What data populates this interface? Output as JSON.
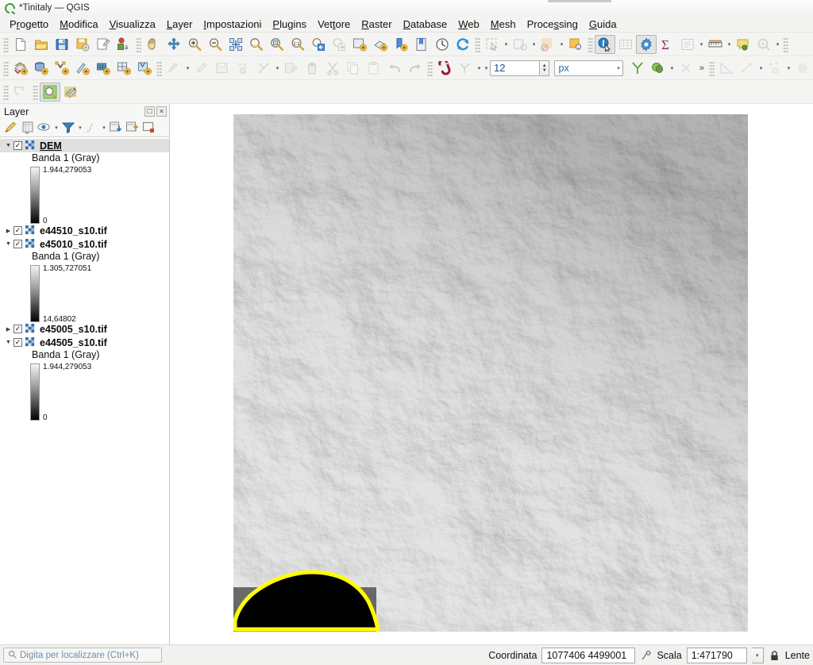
{
  "window": {
    "title": "*Tinitaly — QGIS",
    "logo_icon": "qgis-logo-icon"
  },
  "menubar": {
    "items": [
      {
        "label": "Progetto",
        "mnemonic_index": 1
      },
      {
        "label": "Modifica",
        "mnemonic_index": 0
      },
      {
        "label": "Visualizza",
        "mnemonic_index": 0
      },
      {
        "label": "Layer",
        "mnemonic_index": 0
      },
      {
        "label": "Impostazioni",
        "mnemonic_index": 0
      },
      {
        "label": "Plugins",
        "mnemonic_index": 0
      },
      {
        "label": "Vettore",
        "mnemonic_index": 3
      },
      {
        "label": "Raster",
        "mnemonic_index": 0
      },
      {
        "label": "Database",
        "mnemonic_index": 0
      },
      {
        "label": "Web",
        "mnemonic_index": 0
      },
      {
        "label": "Mesh",
        "mnemonic_index": 0
      },
      {
        "label": "Processing",
        "mnemonic_index": 5
      },
      {
        "label": "Guida",
        "mnemonic_index": 0
      }
    ]
  },
  "toolbars": {
    "row1": [
      {
        "icon": "new-project-icon",
        "name": "new-project-button"
      },
      {
        "icon": "open-project-icon",
        "name": "open-project-button"
      },
      {
        "icon": "save-project-icon",
        "name": "save-project-button"
      },
      {
        "icon": "save-project-as-icon",
        "name": "save-project-as-button"
      },
      {
        "icon": "new-print-layout-icon",
        "name": "new-print-layout-button"
      },
      {
        "icon": "layout-manager-icon",
        "name": "layout-manager-button"
      },
      {
        "icon": "pan-map-icon",
        "name": "pan-map-button"
      },
      {
        "icon": "pan-to-selection-icon",
        "name": "pan-to-selection-button"
      },
      {
        "icon": "zoom-in-icon",
        "name": "zoom-in-button"
      },
      {
        "icon": "zoom-out-icon",
        "name": "zoom-out-button"
      },
      {
        "icon": "zoom-full-icon",
        "name": "zoom-full-button"
      },
      {
        "icon": "zoom-to-selection-icon",
        "name": "zoom-to-selection-button"
      },
      {
        "icon": "zoom-to-layer-icon",
        "name": "zoom-to-layer-button"
      },
      {
        "icon": "zoom-native-icon",
        "name": "zoom-native-resolution-button"
      },
      {
        "icon": "zoom-last-icon",
        "name": "zoom-last-button"
      },
      {
        "icon": "zoom-next-icon",
        "name": "zoom-next-button"
      },
      {
        "icon": "new-map-view-icon",
        "name": "new-map-view-button"
      },
      {
        "icon": "new-3d-map-view-icon",
        "name": "new-3d-map-view-button"
      },
      {
        "icon": "new-bookmark-icon",
        "name": "new-bookmark-button"
      },
      {
        "icon": "show-bookmarks-icon",
        "name": "show-bookmarks-button"
      },
      {
        "icon": "temporal-controller-icon",
        "name": "temporal-controller-button"
      },
      {
        "icon": "refresh-icon",
        "name": "refresh-button"
      },
      {
        "icon": "select-features-icon",
        "name": "select-features-button"
      },
      {
        "icon": "select-by-expression-icon",
        "name": "select-by-expression-button"
      },
      {
        "icon": "deselect-features-icon",
        "name": "deselect-features-button"
      },
      {
        "icon": "select-value-icon",
        "name": "select-value-button"
      },
      {
        "icon": "identify-features-icon",
        "name": "identify-features-button"
      },
      {
        "icon": "open-attribute-table-icon",
        "name": "open-attribute-table-button"
      },
      {
        "icon": "processing-toolbox-icon",
        "name": "processing-toolbox-button"
      },
      {
        "icon": "statistical-summary-icon",
        "name": "statistical-summary-button"
      },
      {
        "icon": "show-statistics-icon",
        "name": "show-statistics-button"
      },
      {
        "icon": "measure-line-icon",
        "name": "measure-line-button"
      },
      {
        "icon": "map-tips-icon",
        "name": "map-tips-button"
      },
      {
        "icon": "show-styling-icon",
        "name": "show-styling-button"
      }
    ],
    "row2": [
      {
        "icon": "add-raster-layer-icon",
        "name": "add-raster-layer-button"
      },
      {
        "icon": "add-db-layer-icon",
        "name": "add-db-layer-button"
      },
      {
        "icon": "add-vector-layer-icon",
        "name": "add-vector-layer-button"
      },
      {
        "icon": "add-pointcloud-layer-icon",
        "name": "add-pointcloud-layer-button"
      },
      {
        "icon": "add-mesh-layer-icon",
        "name": "add-mesh-layer-button"
      },
      {
        "icon": "add-wms-layer-icon",
        "name": "add-wms-layer-button"
      },
      {
        "icon": "add-wfs-layer-icon",
        "name": "add-wfs-layer-button"
      },
      {
        "icon": "current-edits-icon",
        "name": "current-edits-button"
      },
      {
        "icon": "toggle-editing-icon",
        "name": "toggle-editing-button"
      },
      {
        "icon": "save-layer-edits-icon",
        "name": "save-layer-edits-button"
      },
      {
        "icon": "add-feature-icon",
        "name": "add-feature-button"
      },
      {
        "icon": "vertex-tool-icon",
        "name": "vertex-tool-button"
      },
      {
        "icon": "modify-attributes-icon",
        "name": "modify-attributes-button"
      },
      {
        "icon": "delete-selected-icon",
        "name": "delete-selected-button"
      },
      {
        "icon": "cut-features-icon",
        "name": "cut-features-button"
      },
      {
        "icon": "copy-features-icon",
        "name": "copy-features-button"
      },
      {
        "icon": "paste-features-icon",
        "name": "paste-features-button"
      },
      {
        "icon": "undo-icon",
        "name": "undo-button"
      },
      {
        "icon": "redo-icon",
        "name": "redo-button"
      },
      {
        "icon": "snapping-magnet-icon",
        "name": "snapping-toggle-button"
      },
      {
        "icon": "snapping-mode-icon",
        "name": "snapping-mode-button"
      },
      {
        "icon": "topology-intersection-icon",
        "name": "avoid-overlap-button"
      },
      {
        "icon": "trace-icon",
        "name": "enable-tracing-button"
      },
      {
        "icon": "no-snap-icon",
        "name": "self-snapping-button"
      },
      {
        "icon": "measure-angle-icon",
        "name": "measure-angle-button"
      },
      {
        "icon": "offset-curve-icon",
        "name": "offset-curve-button"
      },
      {
        "icon": "reshape-features-icon",
        "name": "reshape-features-button"
      }
    ],
    "row3": [
      {
        "icon": "select-polygon-icon",
        "name": "select-polygon-button"
      },
      {
        "icon": "zoom-search-icon",
        "name": "metasearch-button"
      },
      {
        "icon": "georeferencer-icon",
        "name": "georeferencer-button"
      }
    ],
    "snapping_tolerance": {
      "value": "12",
      "units": "px",
      "name": "snapping-tolerance"
    },
    "overflow_label": "»"
  },
  "layer_panel": {
    "title": "Layer",
    "float_button": "panel-float-icon",
    "close_button": "panel-close-icon",
    "tools": [
      {
        "icon": "open-layer-styling-icon",
        "name": "open-layer-styling-panel"
      },
      {
        "icon": "add-group-icon",
        "name": "add-group-button"
      },
      {
        "icon": "manage-layer-visibility-icon",
        "name": "manage-layer-visibility-button"
      },
      {
        "icon": "filter-legend-icon",
        "name": "filter-legend-button"
      },
      {
        "icon": "filter-legend-expression-icon",
        "name": "filter-legend-by-expression-button"
      },
      {
        "icon": "expand-all-icon",
        "name": "expand-all-button"
      },
      {
        "icon": "collapse-all-icon",
        "name": "collapse-all-button"
      },
      {
        "icon": "remove-layer-icon",
        "name": "remove-layer-button"
      }
    ],
    "layers": [
      {
        "name": "DEM",
        "checked": true,
        "expanded": true,
        "selected": true,
        "band_label": "Banda 1 (Gray)",
        "ramp_max": "1.944,279053",
        "ramp_min": "0",
        "ramp_height": 72
      },
      {
        "name": "e44510_s10.tif",
        "checked": true,
        "expanded": false,
        "selected": false
      },
      {
        "name": "e45010_s10.tif",
        "checked": true,
        "expanded": true,
        "selected": false,
        "band_label": "Banda 1 (Gray)",
        "ramp_max": "1.305,727051",
        "ramp_min": "14,64802",
        "ramp_height": 72
      },
      {
        "name": "e45005_s10.tif",
        "checked": true,
        "expanded": false,
        "selected": false
      },
      {
        "name": "e44505_s10.tif",
        "checked": true,
        "expanded": true,
        "selected": false,
        "band_label": "Banda 1 (Gray)",
        "ramp_max": "1.944,279053",
        "ramp_min": "0",
        "ramp_height": 72
      }
    ]
  },
  "map": {
    "selection_outline_color": "#ffff00",
    "raster_background": "#1e1e1e"
  },
  "statusbar": {
    "locator_placeholder": "Digita per localizzare (Ctrl+K)",
    "locator_icon": "search-icon",
    "coordinate_label": "Coordinata",
    "coordinate_value": "1077406 4499001",
    "coordinate_toggle_icon": "coordinate-capture-icon",
    "scale_label": "Scala",
    "scale_value": "1:471790",
    "scale_dropdown_icon": "chevron-down-icon",
    "lock_icon": "lock-icon",
    "magnifier_label": "Lente"
  }
}
